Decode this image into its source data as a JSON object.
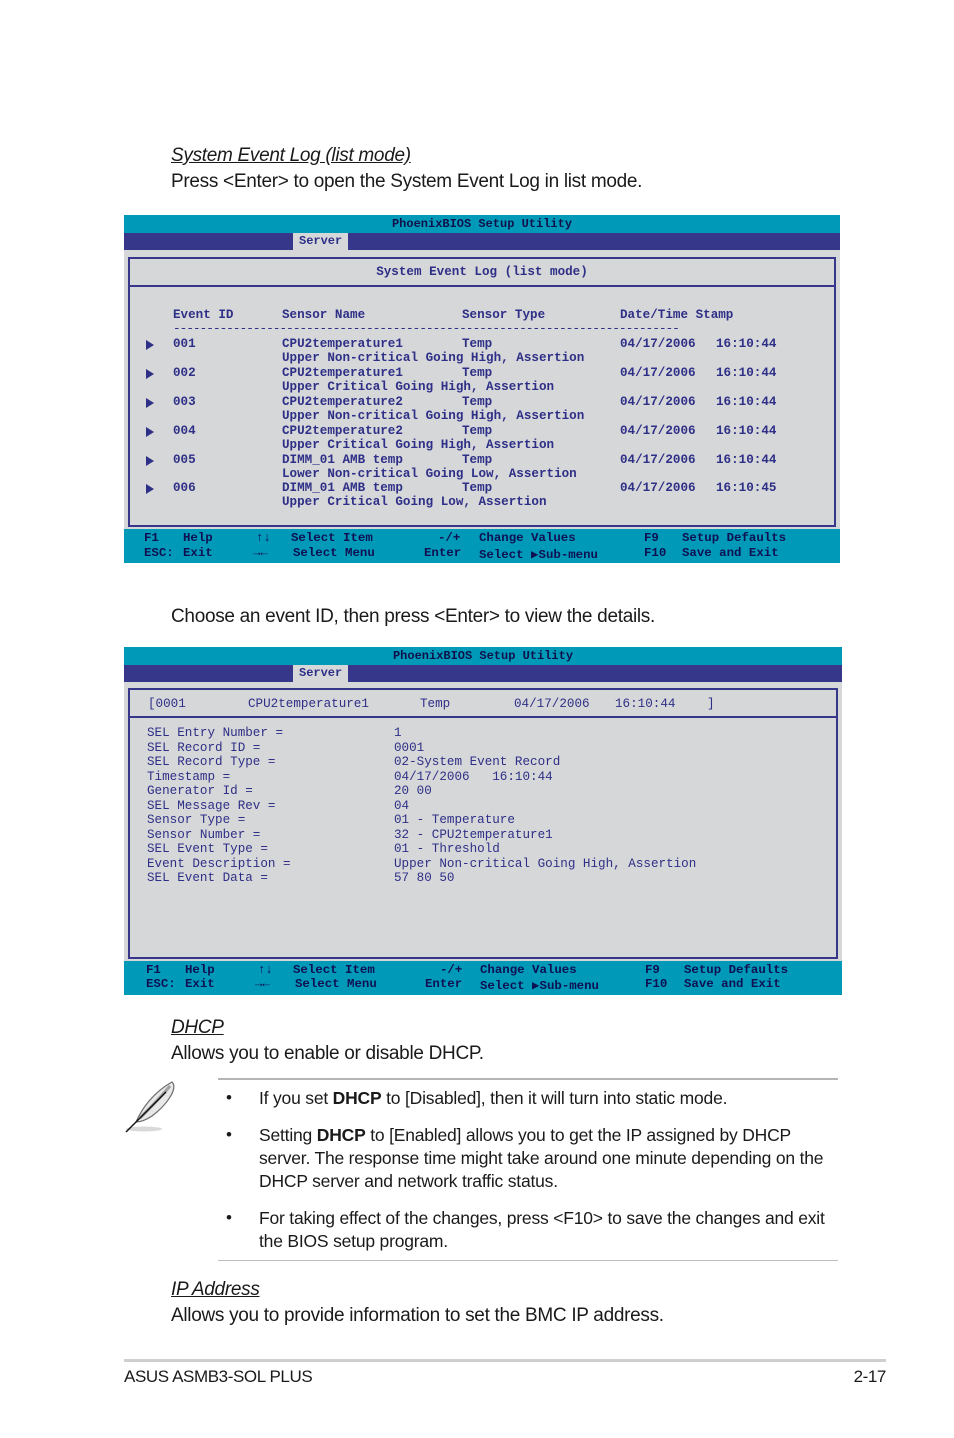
{
  "sections": {
    "sel_list": {
      "heading": "System Event Log (list mode) ",
      "description": "Press <Enter> to open the System Event Log in list mode."
    },
    "sel_detail": {
      "description": "Choose an event ID, then press <Enter> to view the details."
    },
    "dhcp": {
      "heading": "DHCP",
      "description": "Allows you to enable or disable DHCP."
    },
    "ip_address": {
      "heading": "IP Address ",
      "description": "Allows you to provide information to set the BMC IP address."
    }
  },
  "bios_common": {
    "title": "PhoenixBIOS Setup Utility",
    "active_tab": "Server",
    "status": {
      "f1_key": "F1",
      "f1_label": "Help",
      "esc_key": "ESC:",
      "esc_label": "Exit",
      "updown_key": "↑↓",
      "updown_label": "Select Item",
      "leftright_key": "→←",
      "leftright_label": "Select Menu",
      "plusminus_key": "-/+",
      "plusminus_label": "Change Values",
      "enter_key": "Enter",
      "enter_label": "Select ▶Sub-menu",
      "f9_key": "F9",
      "f9_label": "Setup Defaults",
      "f10_key": "F10",
      "f10_label": "Save and Exit"
    }
  },
  "sel_list_screen": {
    "panel_title": "System Event Log (list mode)",
    "columns": [
      "Event ID",
      "Sensor Name",
      "Sensor Type",
      "Date/Time Stamp"
    ],
    "separator": "----------------------------------------------------------------------------",
    "events": [
      {
        "id": "001",
        "sensor_name": "CPU2temperature1",
        "sensor_type": "Temp",
        "date": "04/17/2006",
        "time": "16:10:44",
        "description": "Upper Non-critical Going High, Assertion"
      },
      {
        "id": "002",
        "sensor_name": "CPU2temperature1",
        "sensor_type": "Temp",
        "date": "04/17/2006",
        "time": "16:10:44",
        "description": "Upper Critical Going High, Assertion"
      },
      {
        "id": "003",
        "sensor_name": "CPU2temperature2",
        "sensor_type": "Temp",
        "date": "04/17/2006",
        "time": "16:10:44",
        "description": "Upper Non-critical Going High, Assertion"
      },
      {
        "id": "004",
        "sensor_name": "CPU2temperature2",
        "sensor_type": "Temp",
        "date": "04/17/2006",
        "time": "16:10:44",
        "description": "Upper Critical Going High, Assertion"
      },
      {
        "id": "005",
        "sensor_name": "DIMM_01 AMB temp",
        "sensor_type": "Temp",
        "date": "04/17/2006",
        "time": "16:10:44",
        "description": "Lower Non-critical Going Low, Assertion"
      },
      {
        "id": "006",
        "sensor_name": "DIMM_01 AMB temp",
        "sensor_type": "Temp",
        "date": "04/17/2006",
        "time": "16:10:45",
        "description": "Upper Critical Going Low, Assertion"
      }
    ]
  },
  "sel_detail_screen": {
    "header": {
      "open": "[0001",
      "sensor_name": "CPU2temperature1",
      "sensor_type": "Temp",
      "date": "04/17/2006",
      "time": "16:10:44",
      "close": "]"
    },
    "fields": [
      {
        "label": "SEL Entry Number =",
        "value": "1"
      },
      {
        "label": "SEL Record ID =",
        "value": "0001"
      },
      {
        "label": "SEL Record Type =",
        "value": "02-System Event Record"
      },
      {
        "label": "Timestamp =",
        "value": "04/17/2006   16:10:44"
      },
      {
        "label": "Generator Id =",
        "value": "20 00"
      },
      {
        "label": "SEL Message Rev =",
        "value": "04"
      },
      {
        "label": "Sensor Type =",
        "value": "01 - Temperature"
      },
      {
        "label": "Sensor Number =",
        "value": "32 - CPU2temperature1"
      },
      {
        "label": "SEL Event Type =",
        "value": "01 - Threshold"
      },
      {
        "label": "Event Description =",
        "value": "Upper Non-critical Going High, Assertion"
      },
      {
        "label": "SEL Event Data =",
        "value": "57 80 50"
      }
    ]
  },
  "note": {
    "icon": "feather-pen-icon",
    "bullets": [
      {
        "pre": "If you set ",
        "bold": "DHCP",
        "post": " to [Disabled], then it will turn into static mode."
      },
      {
        "pre": "Setting ",
        "bold": "DHCP",
        "post": " to [Enabled] allows you to get the IP assigned by DHCP server. The response time might take around one minute depending on the DHCP server and network traffic status."
      },
      {
        "pre": "For taking effect of the changes, press <F10> to save the changes and exit the BIOS setup program.",
        "bold": "",
        "post": ""
      }
    ]
  },
  "footer": {
    "product": "ASUS ASMB3-SOL PLUS",
    "page": "2-17"
  }
}
